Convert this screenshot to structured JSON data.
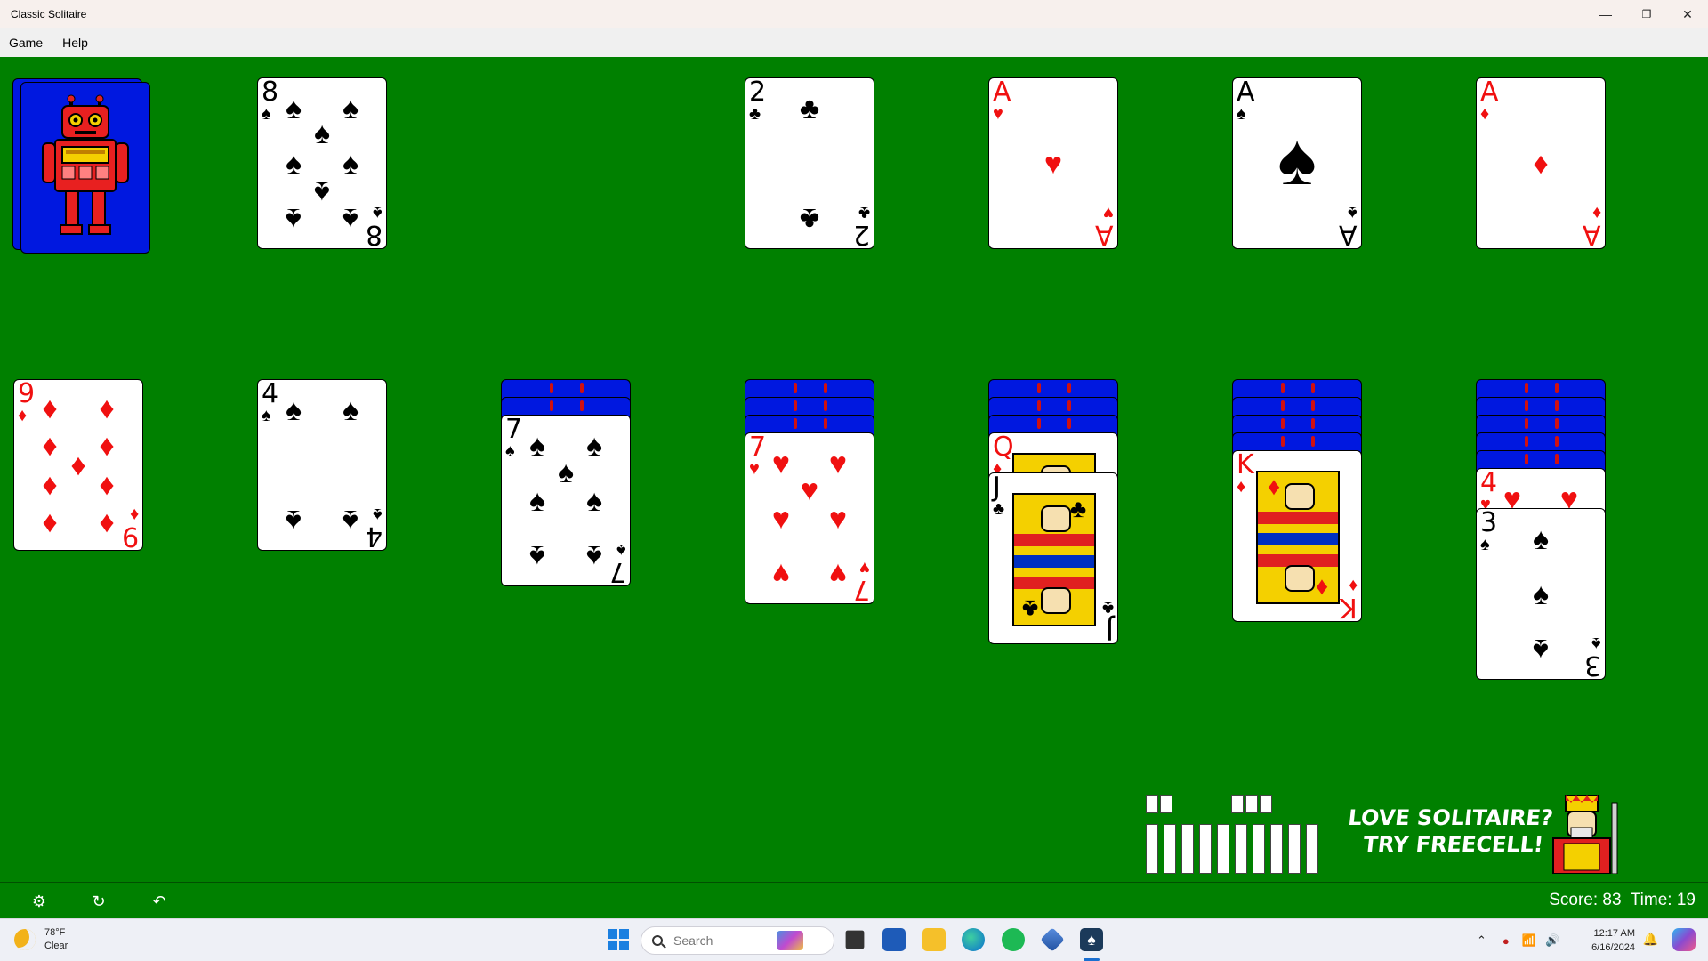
{
  "window": {
    "title": "Classic Solitaire",
    "controls": [
      "—",
      "❐",
      "✕"
    ]
  },
  "menu": [
    {
      "label": "Game"
    },
    {
      "label": "Help"
    }
  ],
  "foundations": [
    {
      "rank": "2",
      "suit": "♣",
      "color": "black"
    },
    {
      "rank": "A",
      "suit": "♥",
      "color": "red"
    },
    {
      "rank": "A",
      "suit": "♠",
      "color": "black"
    },
    {
      "rank": "A",
      "suit": "♦",
      "color": "red"
    }
  ],
  "waste": {
    "rank": "8",
    "suit": "♠",
    "color": "black"
  },
  "tableau": [
    {
      "face_down": 0,
      "cards": [
        {
          "rank": "9",
          "suit": "♦",
          "color": "red"
        }
      ]
    },
    {
      "face_down": 0,
      "cards": [
        {
          "rank": "4",
          "suit": "♠",
          "color": "black"
        }
      ]
    },
    {
      "face_down": 2,
      "cards": [
        {
          "rank": "7",
          "suit": "♠",
          "color": "black"
        }
      ]
    },
    {
      "face_down": 3,
      "cards": [
        {
          "rank": "7",
          "suit": "♥",
          "color": "red"
        }
      ]
    },
    {
      "face_down": 3,
      "cards": [
        {
          "rank": "Q",
          "suit": "♦",
          "color": "red"
        },
        {
          "rank": "J",
          "suit": "♣",
          "color": "black"
        }
      ]
    },
    {
      "face_down": 4,
      "cards": [
        {
          "rank": "K",
          "suit": "♦",
          "color": "red"
        }
      ]
    },
    {
      "face_down": 5,
      "cards": [
        {
          "rank": "4",
          "suit": "♥",
          "color": "red"
        },
        {
          "rank": "3",
          "suit": "♠",
          "color": "black"
        }
      ]
    }
  ],
  "ad": {
    "line1": "LOVE SOLITAIRE?",
    "line2": "TRY FREECELL!"
  },
  "status": {
    "score_label": "Score: 83",
    "time_label": "Time: 19"
  },
  "toolbar_icons": [
    "gear-icon",
    "refresh-icon",
    "undo-icon"
  ],
  "taskbar": {
    "weather_temp": "78°F",
    "weather_cond": "Clear",
    "search_placeholder": "Search",
    "time": "12:17 AM",
    "date": "6/16/2024",
    "apps": [
      "windows-start-icon",
      "copilot-icon",
      "file-manager-icon",
      "store-icon",
      "folder-icon",
      "edge-icon",
      "spotify-icon",
      "network-app-icon",
      "solitaire-icon"
    ]
  },
  "colors": {
    "felt": "#008000",
    "card_back": "#0018e0",
    "red_suit": "#f01010",
    "black_suit": "#000000"
  }
}
